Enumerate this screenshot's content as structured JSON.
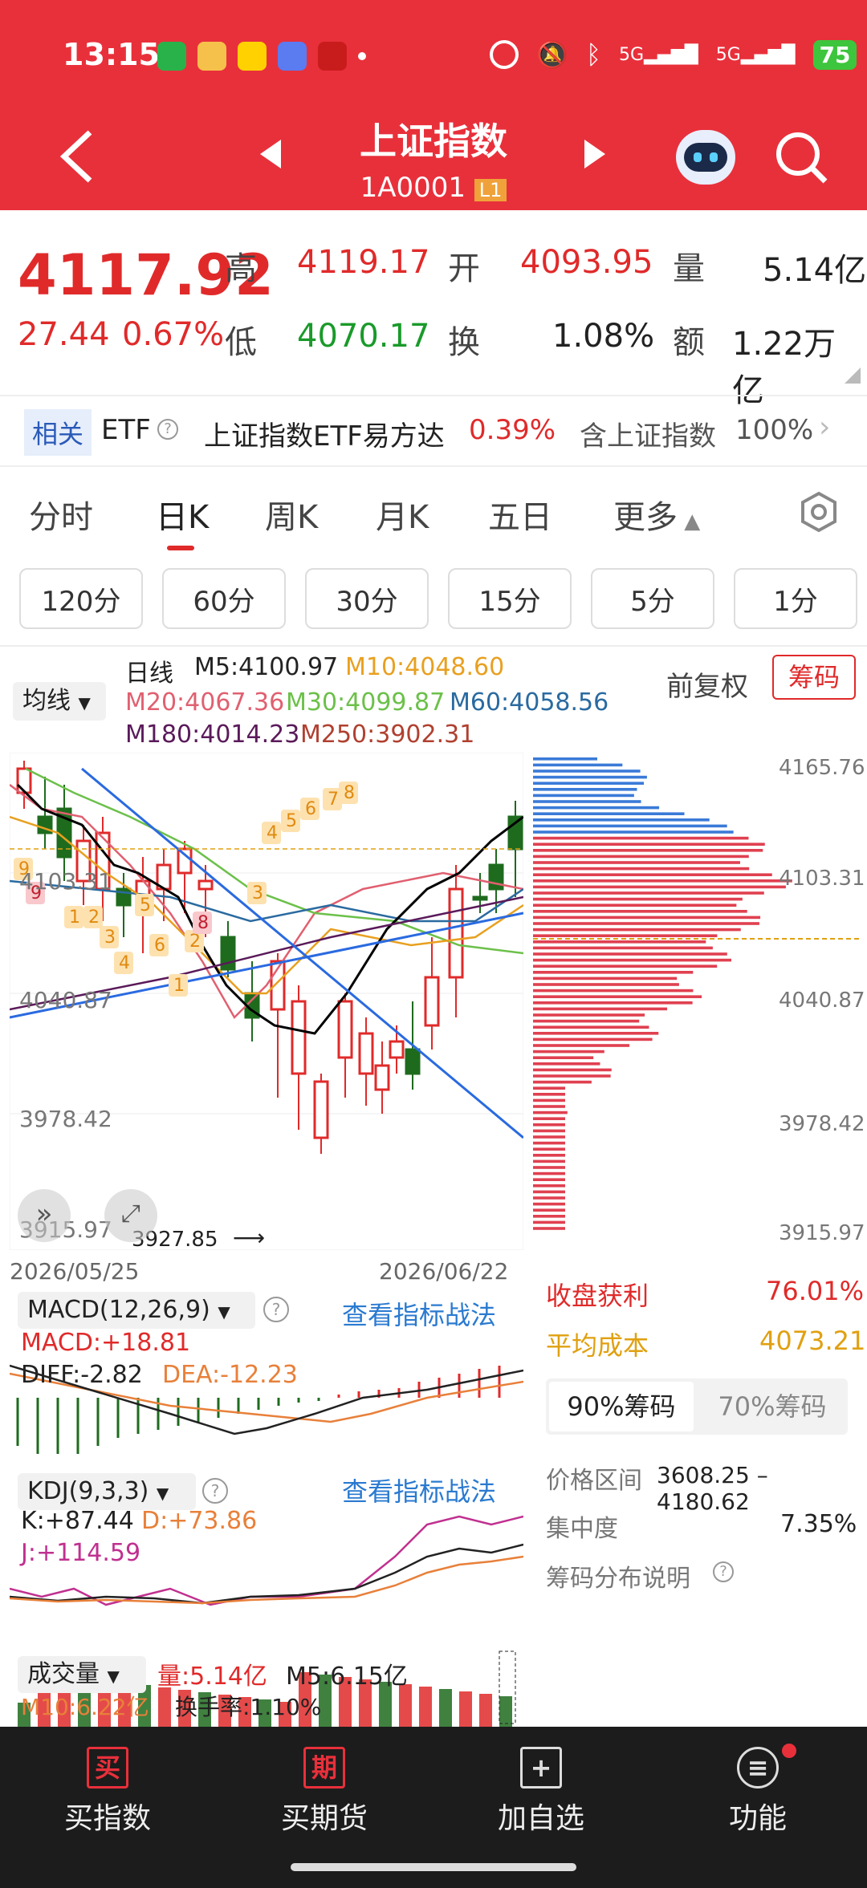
{
  "status": {
    "time": "13:15",
    "battery": "75",
    "app_icons": [
      "wechat-icon",
      "weibo-icon",
      "meituan-icon",
      "browser-icon",
      "stock-app-icon"
    ],
    "network": [
      "5G",
      "5G"
    ]
  },
  "header": {
    "title": "上证指数",
    "code": "1A0001",
    "level": "L1"
  },
  "quote": {
    "price": "4117.92",
    "change": "27.44",
    "change_pct": "0.67%",
    "high_label": "高",
    "high": "4119.17",
    "open_label": "开",
    "open": "4093.95",
    "vol_label": "量",
    "vol": "5.14亿",
    "low_label": "低",
    "low": "4070.17",
    "turn_label": "换",
    "turn": "1.08%",
    "amt_label": "额",
    "amt": "1.22万亿"
  },
  "related": {
    "tag": "相关",
    "etf": "ETF",
    "name": "上证指数ETF易方达",
    "pct": "0.39%",
    "desc": "含上证指数",
    "weight": "100%"
  },
  "tabs": [
    "分时",
    "日K",
    "周K",
    "月K",
    "五日",
    "更多"
  ],
  "active_tab": "日K",
  "intervals": [
    "120分",
    "60分",
    "30分",
    "15分",
    "5分",
    "1分"
  ],
  "ma": {
    "selector": "均线",
    "line": "日线",
    "m5": "M5:4100.97",
    "m10": "M10:4048.60",
    "m20": "M20:4067.36",
    "m30": "M30:4099.87",
    "m60": "M60:4058.56",
    "m180": "M180:4014.23",
    "m250": "M250:3902.31",
    "adjust": "前复权",
    "chips_btn": "筹码"
  },
  "kchart": {
    "price_labels": [
      "4103.31",
      "4040.87",
      "3978.42",
      "3915.97"
    ],
    "low_mark": "3927.85",
    "date_start": "2026/05/25",
    "date_end": "2026/06/22",
    "colors": {
      "up": "#e02a2a",
      "down": "#1e6b1e",
      "ma5": "#000000",
      "ma10": "#e8a020",
      "ma20": "#e06070",
      "ma30": "#6cc04a",
      "ma60": "#2a6aa0",
      "ma180": "#5a1a5a",
      "trend": "#2a6ae0"
    },
    "counts_up": [
      "1",
      "2",
      "3",
      "4",
      "5",
      "6",
      "1",
      "2",
      "3",
      "4",
      "5",
      "6",
      "7",
      "8",
      "9"
    ],
    "counts_down": [
      "9",
      "8"
    ]
  },
  "chips": {
    "price_labels": [
      "4165.76",
      "4103.31",
      "4040.87",
      "3978.42",
      "3915.97"
    ],
    "profit_label": "收盘获利",
    "profit": "76.01%",
    "avg_label": "平均成本",
    "avg": "4073.21",
    "tab90": "90%筹码",
    "tab70": "70%筹码",
    "range_label": "价格区间",
    "range": "3608.25 – 4180.62",
    "conc_label": "集中度",
    "conc": "7.35%",
    "explain": "筹码分布说明"
  },
  "macd": {
    "title": "MACD(12,26,9)",
    "link": "查看指标战法",
    "macd": "MACD:+18.81",
    "diff": "DIFF:-2.82",
    "dea": "DEA:-12.23"
  },
  "kdj": {
    "title": "KDJ(9,3,3)",
    "link": "查看指标战法",
    "k": "K:+87.44",
    "d": "D:+73.86",
    "j": "J:+114.59"
  },
  "volume": {
    "title": "成交量",
    "vol": "量:5.14亿",
    "m5": "M5:6.15亿",
    "m10": "M10:6.22亿",
    "turn": "换手率:1.10%"
  },
  "nav": [
    {
      "label": "买指数",
      "icon": "买"
    },
    {
      "label": "买期货",
      "icon": "期"
    },
    {
      "label": "加自选",
      "icon": "+"
    },
    {
      "label": "功能",
      "icon": "≡"
    }
  ]
}
